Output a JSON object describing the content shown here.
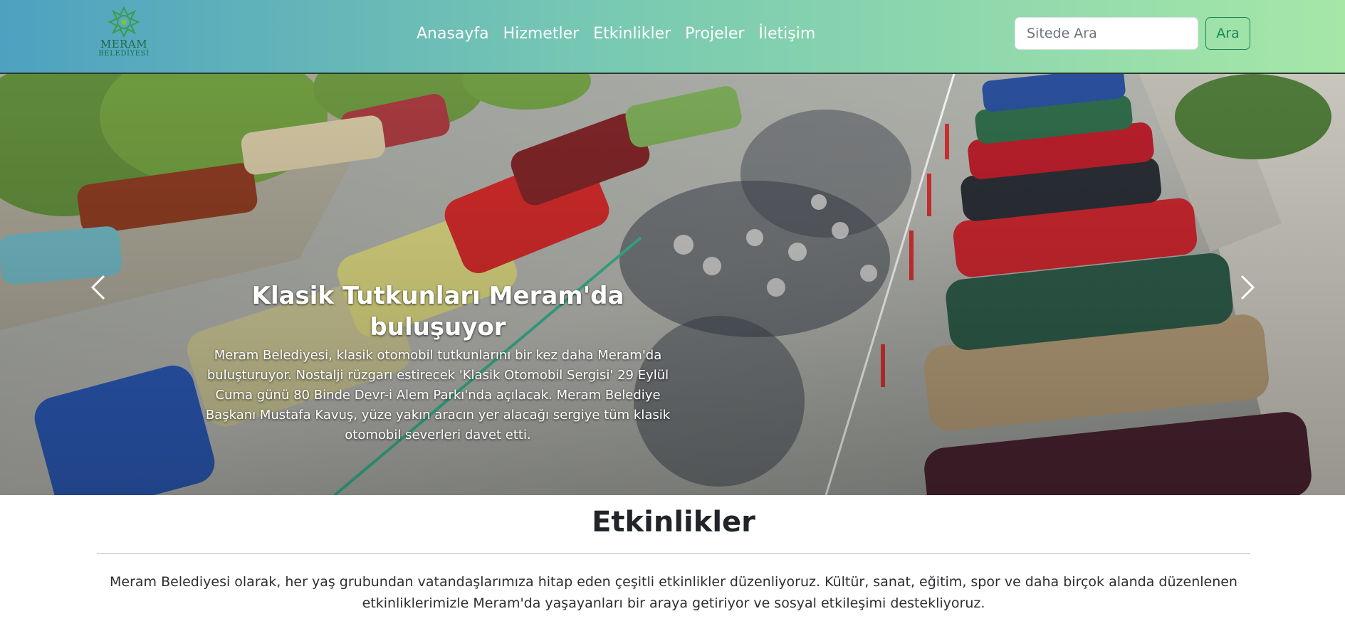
{
  "navbar": {
    "logo": {
      "line1": "MERAM",
      "line2": "BELEDİYESİ",
      "icon": "rosette-logo-icon",
      "color": "#1f6a4a"
    },
    "links": [
      {
        "label": "Anasayfa"
      },
      {
        "label": "Hizmetler"
      },
      {
        "label": "Etkinlikler"
      },
      {
        "label": "Projeler"
      },
      {
        "label": "İletişim"
      }
    ],
    "search": {
      "placeholder": "Sitede Ara",
      "value": "",
      "button_label": "Ara"
    },
    "gradient": [
      "#4ea1c0",
      "#78c9b2",
      "#a6e7a8"
    ]
  },
  "carousel": {
    "slide": {
      "title": "Klasik Tutkunları Meram'da buluşuyor",
      "text": "Meram Belediyesi, klasik otomobil tutkunlarını bir kez daha Meram'da buluşturuyor. Nostalji rüzgarı estirecek 'Klasik Otomobil Sergisi' 29 Eylül Cuma günü 80 Binde Devr-i Alem Parkı'nda açılacak. Meram Belediye Başkanı Mustafa Kavuş, yüze yakın aracın yer alacağı sergiye tüm klasik otomobil severleri davet etti."
    },
    "prev_icon": "chevron-left-icon",
    "next_icon": "chevron-right-icon"
  },
  "events_section": {
    "title": "Etkinlikler",
    "description": "Meram Belediyesi olarak, her yaş grubundan vatandaşlarımıza hitap eden çeşitli etkinlikler düzenliyoruz. Kültür, sanat, eğitim, spor ve daha birçok alanda düzenlenen etkinliklerimizle Meram'da yaşayanları bir araya getiriyor ve sosyal etkileşimi destekliyoruz."
  }
}
